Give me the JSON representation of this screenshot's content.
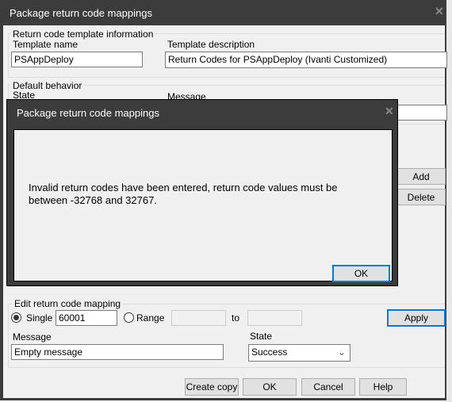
{
  "window": {
    "title": "Package return code mappings",
    "close_icon": "close-icon"
  },
  "template_info": {
    "legend": "Return code template information",
    "name_label": "Template name",
    "name_value": "PSAppDeploy",
    "desc_label": "Template description",
    "desc_value": "Return Codes for PSAppDeploy (Ivanti Customized)"
  },
  "default_behavior": {
    "legend": "Default behavior",
    "state_label": "State",
    "message_label": "Message"
  },
  "list_buttons": {
    "add": "Add",
    "delete": "Delete"
  },
  "edit": {
    "legend": "Edit return code mapping",
    "single_label": "Single",
    "single_value": "60001",
    "single_selected": true,
    "range_label": "Range",
    "to_label": "to",
    "apply": "Apply",
    "message_label": "Message",
    "message_value": "Empty message",
    "state_label": "State",
    "state_value": "Success"
  },
  "footer": {
    "create_copy": "Create copy",
    "ok": "OK",
    "cancel": "Cancel",
    "help": "Help"
  },
  "modal": {
    "title": "Package return code mappings",
    "message": "Invalid return codes have been entered, return code values must be between -32768 and 32767.",
    "ok": "OK"
  }
}
